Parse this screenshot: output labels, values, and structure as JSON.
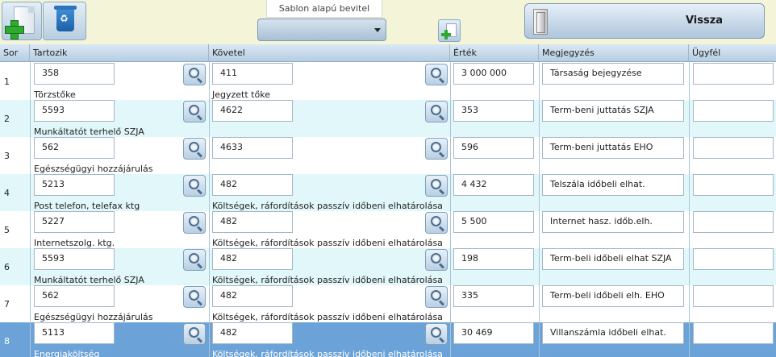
{
  "toolbar": {
    "sablon_label": "Sablon alapú bevitel",
    "sablon_selected": "",
    "vissza_label": "Vissza"
  },
  "columns": {
    "sor": "Sor",
    "tartozik": "Tartozik",
    "kovetel": "Követel",
    "ertek": "Érték",
    "megjegyzes": "Megjegyzés",
    "ugyfel": "Ügyfél"
  },
  "rows": [
    {
      "sor": "1",
      "tartozik": "358",
      "tartozik_name": "Törzstőke",
      "kovetel": "411",
      "kovetel_name": "Jegyzett tőke",
      "ertek": "3 000 000",
      "megjegyzes": "Társaság bejegyzése",
      "ugyfel": ""
    },
    {
      "sor": "2",
      "tartozik": "5593",
      "tartozik_name": "Munkáltatót terhelő SZJA",
      "kovetel": "4622",
      "kovetel_name": "",
      "ertek": "353",
      "megjegyzes": "Term-beni juttatás SZJA",
      "ugyfel": ""
    },
    {
      "sor": "3",
      "tartozik": "562",
      "tartozik_name": "Egészségügyi hozzájárulás",
      "kovetel": "4633",
      "kovetel_name": "",
      "ertek": "596",
      "megjegyzes": "Term-beni juttatás EHO",
      "ugyfel": ""
    },
    {
      "sor": "4",
      "tartozik": "5213",
      "tartozik_name": "Post telefon, telefax ktg",
      "kovetel": "482",
      "kovetel_name": "Költségek, ráfordítások passzív időbeni elhatárolása",
      "ertek": "4 432",
      "megjegyzes": "Telszála időbeli elhat.",
      "ugyfel": ""
    },
    {
      "sor": "5",
      "tartozik": "5227",
      "tartozik_name": "Internetszolg. ktg.",
      "kovetel": "482",
      "kovetel_name": "Költségek, ráfordítások passzív időbeni elhatárolása",
      "ertek": "5 500",
      "megjegyzes": "Internet hasz. időb.elh.",
      "ugyfel": ""
    },
    {
      "sor": "6",
      "tartozik": "5593",
      "tartozik_name": "Munkáltatót terhelő SZJA",
      "kovetel": "482",
      "kovetel_name": "Költségek, ráfordítások passzív időbeni elhatárolása",
      "ertek": "198",
      "megjegyzes": "Term-beli időbeli elhat SZJA",
      "ugyfel": ""
    },
    {
      "sor": "7",
      "tartozik": "562",
      "tartozik_name": "Egészségügyi hozzájárulás",
      "kovetel": "482",
      "kovetel_name": "Költségek, ráfordítások passzív időbeni elhatárolása",
      "ertek": "335",
      "megjegyzes": "Term-beli időbeli elh. EHO",
      "ugyfel": ""
    },
    {
      "sor": "8",
      "tartozik": "5113",
      "tartozik_name": "Energiaköltség",
      "kovetel": "482",
      "kovetel_name": "Költségek, ráfordítások passzív időbeni elhatárolása",
      "ertek": "30 469",
      "megjegyzes": "Villanszámla időbeli elhat.",
      "ugyfel": ""
    }
  ],
  "selected_row": "8",
  "colors": {
    "row_alt": "#e1f7f9",
    "row_selected": "#6ba3d8",
    "toolbar_bg": "#f4f4d8"
  }
}
